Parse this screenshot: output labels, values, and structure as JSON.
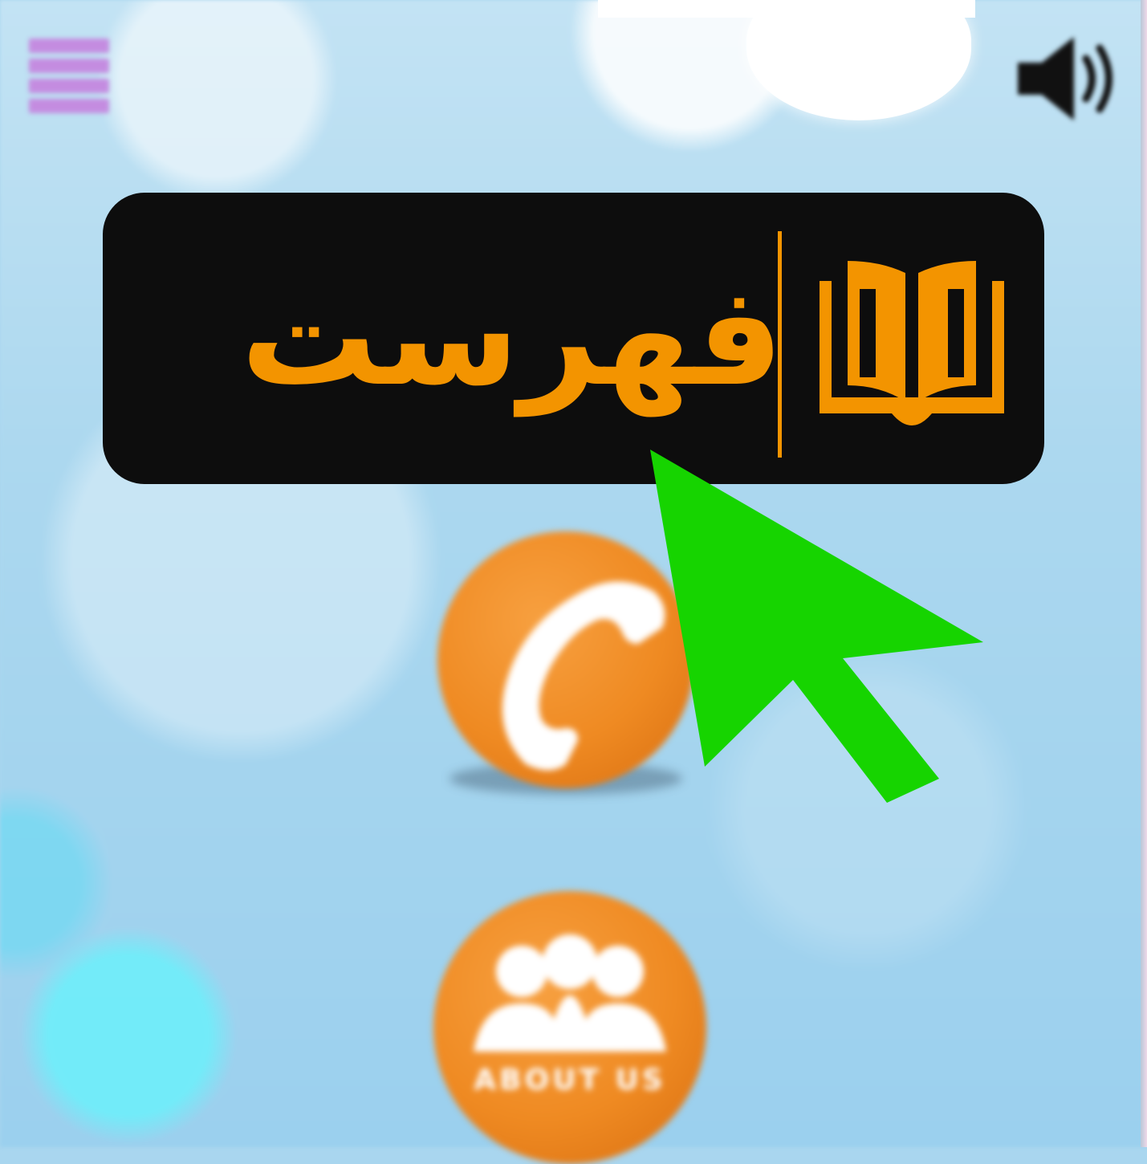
{
  "menu_button": {
    "icon": "hamburger-menu-icon",
    "color": "#c48ce0"
  },
  "sound_button": {
    "icon": "speaker-icon"
  },
  "banner": {
    "label": "فهرست",
    "icon": "open-book-icon",
    "text_color": "#f39400",
    "background": "#0d0d0d"
  },
  "buttons": [
    {
      "name": "call",
      "icon": "phone-icon"
    },
    {
      "name": "about",
      "icon": "people-icon",
      "label": "ABOUT US"
    }
  ],
  "cursor": {
    "icon": "arrow-cursor-icon",
    "color": "#16d400"
  }
}
